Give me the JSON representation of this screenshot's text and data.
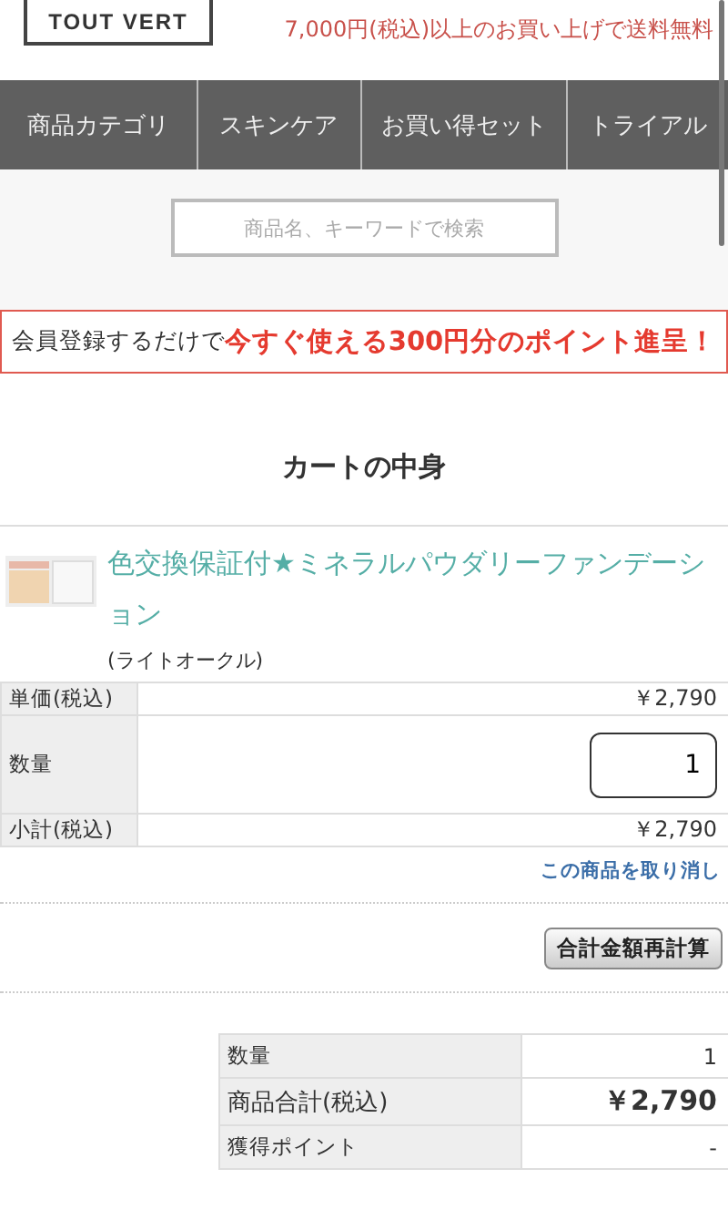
{
  "header": {
    "logo": "TOUT VERT",
    "shipping_note": "7,000円(税込)以上のお買い上げで送料無料"
  },
  "nav": [
    {
      "label": "商品カテゴリ"
    },
    {
      "label": "スキンケア"
    },
    {
      "label": "お買い得セット"
    },
    {
      "label": "トライアル"
    }
  ],
  "search": {
    "placeholder": "商品名、キーワードで検索"
  },
  "banner": "会員登録するだけで**今すぐ使える300円分のポイント進呈！**",
  "cart_title": "カートの中身",
  "item": {
    "name": "色交換保証付★ミネラルパウダリーファンデーション",
    "variant": "(ライトオークル)",
    "rows": [
      {
        "kind": "text",
        "label": "単価(税込)",
        "value": "￥2,790"
      },
      {
        "kind": "input",
        "label": "数量",
        "value": "1"
      },
      {
        "kind": "text",
        "label": "小計(税込)",
        "value": "￥2,790"
      }
    ],
    "remove_link": "この商品を取り消し"
  },
  "recalc_button": "合計金額再計算",
  "summary": [
    {
      "label": "数量",
      "value": "1",
      "emphasis": false
    },
    {
      "label": "商品合計(税込)",
      "value": "￥2,790",
      "emphasis": true
    },
    {
      "label": "獲得ポイント",
      "value": "-",
      "emphasis": false
    }
  ]
}
